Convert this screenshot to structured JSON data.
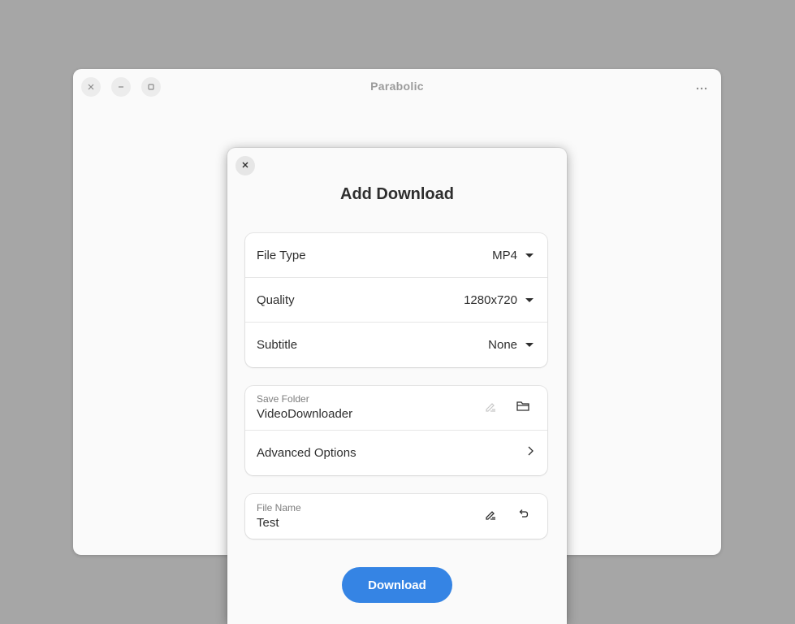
{
  "window": {
    "title": "Parabolic"
  },
  "dialog": {
    "title": "Add Download",
    "format_group": {
      "file_type": {
        "label": "File Type",
        "value": "MP4"
      },
      "quality": {
        "label": "Quality",
        "value": "1280x720"
      },
      "subtitle": {
        "label": "Subtitle",
        "value": "None"
      }
    },
    "save_group": {
      "save_folder": {
        "caption": "Save Folder",
        "value": "VideoDownloader"
      },
      "advanced": {
        "label": "Advanced Options"
      }
    },
    "name_group": {
      "file_name": {
        "caption": "File Name",
        "value": "Test"
      }
    },
    "download_label": "Download"
  },
  "icons": {
    "window_close": "close-icon",
    "window_minimize": "minimize-icon",
    "window_maximize": "maximize-icon",
    "menu": "more-icon",
    "dialog_close": "close-icon",
    "dropdown": "caret-down-icon",
    "edit": "edit-icon",
    "folder": "folder-icon",
    "chevron": "chevron-right-icon",
    "undo": "undo-icon"
  },
  "colors": {
    "accent": "#3584e4",
    "backdrop": "#a6a6a6",
    "surface": "#fafafa"
  }
}
